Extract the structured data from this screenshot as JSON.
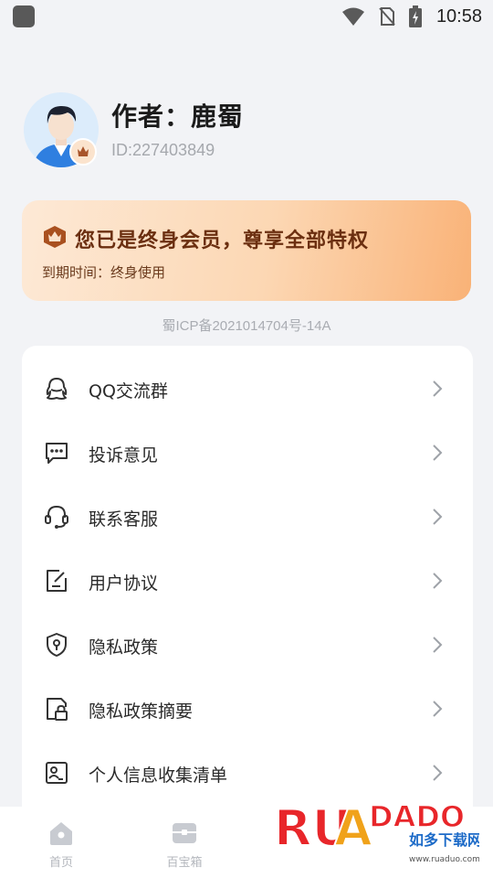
{
  "status_bar": {
    "time": "10:58",
    "icons": [
      "app-icon",
      "wifi-icon",
      "no-sim-icon",
      "battery-charging-icon"
    ]
  },
  "profile": {
    "author": "作者：鹿蜀",
    "id": "ID:227403849",
    "avatar_icon": "person-avatar",
    "badge_icon": "crown-badge-icon"
  },
  "vip": {
    "title": "您已是终身会员，尊享全部特权",
    "expiry": "到期时间：终身使用",
    "icon": "crown-icon",
    "colors": {
      "start": "#fde9d6",
      "end": "#f9b277",
      "text": "#6b2f10"
    }
  },
  "icp": "蜀ICP备2021014704号-14A",
  "menu": {
    "items": [
      {
        "label": "QQ交流群",
        "icon": "qq-icon"
      },
      {
        "label": "投诉意见",
        "icon": "chat-dots-icon"
      },
      {
        "label": "联系客服",
        "icon": "headset-icon"
      },
      {
        "label": "用户协议",
        "icon": "edit-document-icon"
      },
      {
        "label": "隐私政策",
        "icon": "shield-icon"
      },
      {
        "label": "隐私政策摘要",
        "icon": "document-lock-icon"
      },
      {
        "label": "个人信息收集清单",
        "icon": "id-card-icon"
      }
    ]
  },
  "bottom_nav": {
    "items": [
      {
        "label": "首页",
        "icon": "home-icon"
      },
      {
        "label": "百宝箱",
        "icon": "treasure-box-icon"
      }
    ]
  },
  "watermark": {
    "brand": "RUANDADO",
    "tagline": "如多下载网",
    "url": "www.ruaduo.com"
  }
}
